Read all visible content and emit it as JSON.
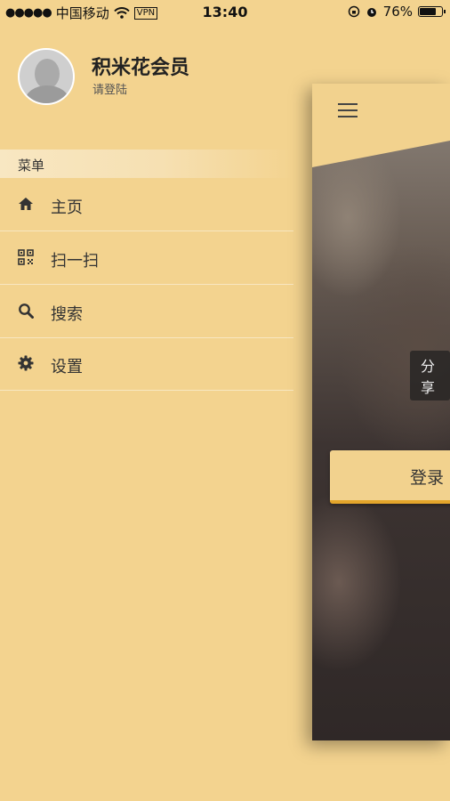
{
  "status_bar": {
    "signal_dots": "●●●●●",
    "carrier": "中国移动",
    "wifi_icon": "wifi-icon",
    "vpn": "VPN",
    "time": "13:40",
    "battery_percent": "76%",
    "battery_level": 0.76
  },
  "profile": {
    "name": "积米花会员",
    "subtitle": "请登陆"
  },
  "menu": {
    "header": "菜单",
    "items": [
      {
        "label": "主页",
        "icon": "home-icon"
      },
      {
        "label": "扫一扫",
        "icon": "qr-code-icon"
      },
      {
        "label": "搜索",
        "icon": "search-icon"
      },
      {
        "label": "设置",
        "icon": "gear-icon"
      }
    ]
  },
  "content": {
    "share_label": "分享",
    "login_label": "登录"
  },
  "colors": {
    "background": "#f3d38f",
    "accent": "#e3a52b"
  }
}
